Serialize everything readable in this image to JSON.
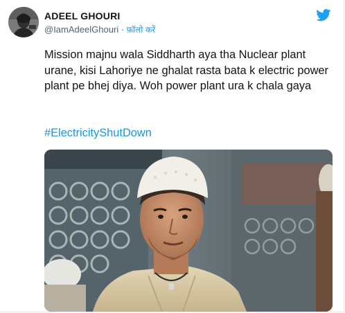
{
  "author": {
    "name": "ADEEL GHOURI",
    "handle": "@IamAdeelGhouri",
    "separator": "·",
    "follow_label": "फ़ॉलो करें"
  },
  "tweet": {
    "text": "Mission majnu wala Siddharth aya tha Nuclear plant urane, kisi Lahoriye ne ghalat rasta bata k electric power plant pe bhej diya. Woh power plant ura k chala gaya",
    "hashtag": "#ElectricityShutDown"
  },
  "icons": {
    "brand": "twitter-bird-icon"
  },
  "colors": {
    "link": "#1b95e0",
    "text": "#0f1419",
    "secondary_text": "#536471",
    "border": "#e1e8ed"
  }
}
